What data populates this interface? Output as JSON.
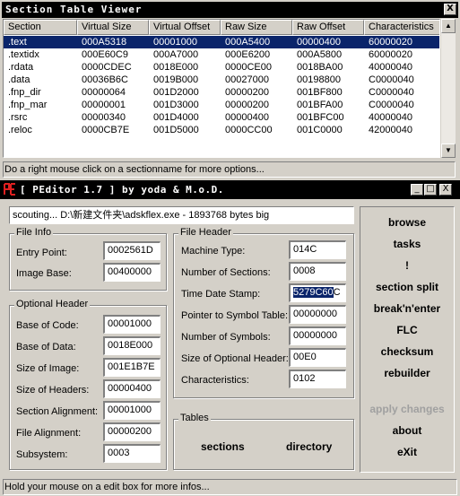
{
  "section_viewer": {
    "title": "Section Table Viewer",
    "close_label": "X",
    "columns": [
      "Section",
      "Virtual Size",
      "Virtual Offset",
      "Raw Size",
      "Raw Offset",
      "Characteristics"
    ],
    "rows": [
      [
        ".text",
        "000A5318",
        "00001000",
        "000A5400",
        "00000400",
        "60000020"
      ],
      [
        ".textidx",
        "000E60C9",
        "000A7000",
        "000E6200",
        "000A5800",
        "60000020"
      ],
      [
        ".rdata",
        "0000CDEC",
        "0018E000",
        "0000CE00",
        "0018BA00",
        "40000040"
      ],
      [
        ".data",
        "00036B6C",
        "0019B000",
        "00027000",
        "00198800",
        "C0000040"
      ],
      [
        ".fnp_dir",
        "00000064",
        "001D2000",
        "00000200",
        "001BF800",
        "C0000040"
      ],
      [
        ".fnp_mar",
        "00000001",
        "001D3000",
        "00000200",
        "001BFA00",
        "C0000040"
      ],
      [
        ".rsrc",
        "00000340",
        "001D4000",
        "00000400",
        "001BFC00",
        "40000040"
      ],
      [
        ".reloc",
        "0000CB7E",
        "001D5000",
        "0000CC00",
        "001C0000",
        "42000040"
      ]
    ],
    "selected_row": 0,
    "status": "Do a right mouse click on a sectionname for more options..."
  },
  "peditor": {
    "title": "[ PEditor 1.7 ]  by yoda & M.o.D.",
    "window_buttons": [
      "_",
      "□",
      "X"
    ],
    "path": "scouting... D:\\新建文件夹\\adskflex.exe - 1893768 bytes big",
    "file_info": {
      "title": "File Info",
      "entry_point_label": "Entry Point:",
      "entry_point": "0002561D",
      "image_base_label": "Image Base:",
      "image_base": "00400000"
    },
    "optional_header": {
      "title": "Optional Header",
      "fields": [
        {
          "label": "Base of Code:",
          "value": "00001000"
        },
        {
          "label": "Base of Data:",
          "value": "0018E000"
        },
        {
          "label": "Size of Image:",
          "value": "001E1B7E"
        },
        {
          "label": "Size of Headers:",
          "value": "00000400"
        },
        {
          "label": "Section Alignment:",
          "value": "00001000"
        },
        {
          "label": "File Alignment:",
          "value": "00000200"
        },
        {
          "label": "Subsystem:",
          "value": "0003"
        }
      ]
    },
    "file_header": {
      "title": "File Header",
      "fields": [
        {
          "label": "Machine Type:",
          "value": "014C"
        },
        {
          "label": "Number of Sections:",
          "value": "0008"
        },
        {
          "label": "Time Date Stamp:",
          "value_selected": "5279C60",
          "value_rest": "C"
        },
        {
          "label": "Pointer to Symbol Table:",
          "value": "00000000"
        },
        {
          "label": "Number of Symbols:",
          "value": "00000000"
        },
        {
          "label": "Size of Optional Header:",
          "value": "00E0"
        },
        {
          "label": "Characteristics:",
          "value": "0102"
        }
      ]
    },
    "tables": {
      "title": "Tables",
      "sections_label": "sections",
      "directory_label": "directory"
    },
    "buttons": [
      "browse",
      "tasks",
      "!",
      "section split",
      "break'n'enter",
      "FLC",
      "checksum",
      "rebuilder",
      "apply changes",
      "about",
      "eXit"
    ],
    "status": "Hold your mouse on a edit box for more infos..."
  }
}
